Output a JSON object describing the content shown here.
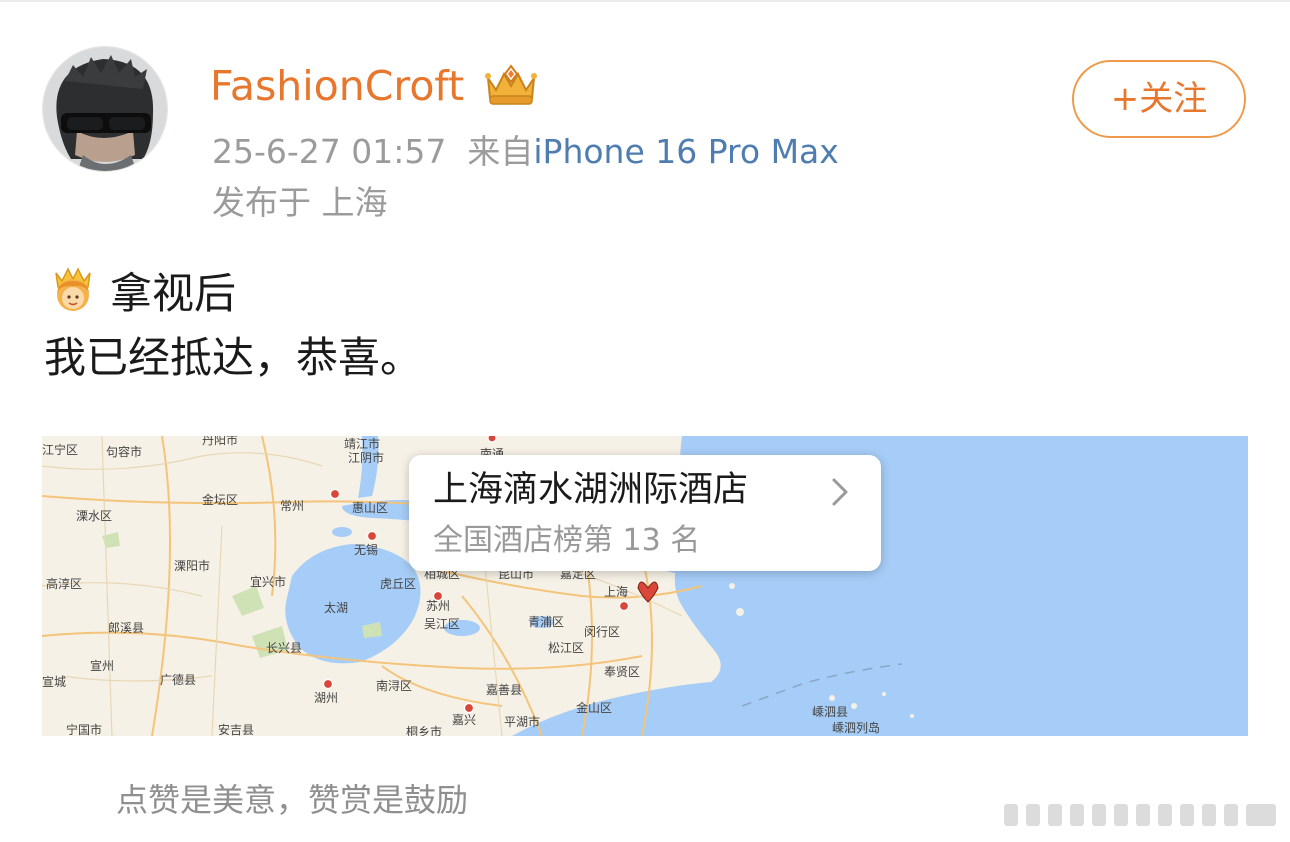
{
  "header": {
    "username": "FashionCroft",
    "timestamp": "25-6-27 01:57",
    "source_prefix": "来自",
    "device": "iPhone 16 Pro Max",
    "location": "发布于 上海",
    "follow_label": "+关注"
  },
  "post": {
    "line1": "拿视后",
    "line2": "我已经抵达，恭喜。"
  },
  "map": {
    "popup_title": "上海滴水湖洲际酒店",
    "popup_subtitle": "全国酒店榜第 13 名",
    "labels": {
      "jingjiang": "靖江市",
      "jiangyin": "江阴市",
      "nantong": "南通",
      "danyang": "丹阳市",
      "changzhou": "常州",
      "jintan": "金坛区",
      "liyang": "溧阳市",
      "wuxi": "无锡",
      "huishan": "惠山区",
      "yixing": "宜兴市",
      "taihu": "太湖",
      "huqiu": "虎丘区",
      "xiangcheng": "相城区",
      "kunshan": "昆山市",
      "jiading": "嘉定区",
      "suzhou": "苏州",
      "wuzhong": "吴江区",
      "qingpu": "青浦区",
      "minhang": "闵行区",
      "songjiang": "松江区",
      "fengxian": "奉贤区",
      "shanghai": "上海",
      "jiashan": "嘉善县",
      "jinshan": "金山区",
      "pinghu": "平湖市",
      "jiaxing": "嘉兴",
      "nanxun": "南浔区",
      "huzhou": "湖州",
      "changxing": "长兴县",
      "anji": "安吉县",
      "guangde": "广德县",
      "langxi": "郎溪县",
      "gaochun": "高淳区",
      "lishui": "溧水区",
      "jurong": "句容市",
      "jiangning": "江宁区",
      "xuancheng": "宣城",
      "ningguo": "宁国市",
      "tonglu": "桐乡市",
      "xuanzhou": "宣州",
      "shengsi": "嵊泗县",
      "shengsi_islands": "嵊泗列岛"
    }
  },
  "footer": {
    "reward_text": "点赞是美意，赞赏是鼓励"
  },
  "colors": {
    "brand_orange": "#e8772e",
    "device_blue": "#4f7db0",
    "meta_gray": "#9b9b9b",
    "sea_blue": "#a6cdf7",
    "land": "#f6f1e6"
  }
}
